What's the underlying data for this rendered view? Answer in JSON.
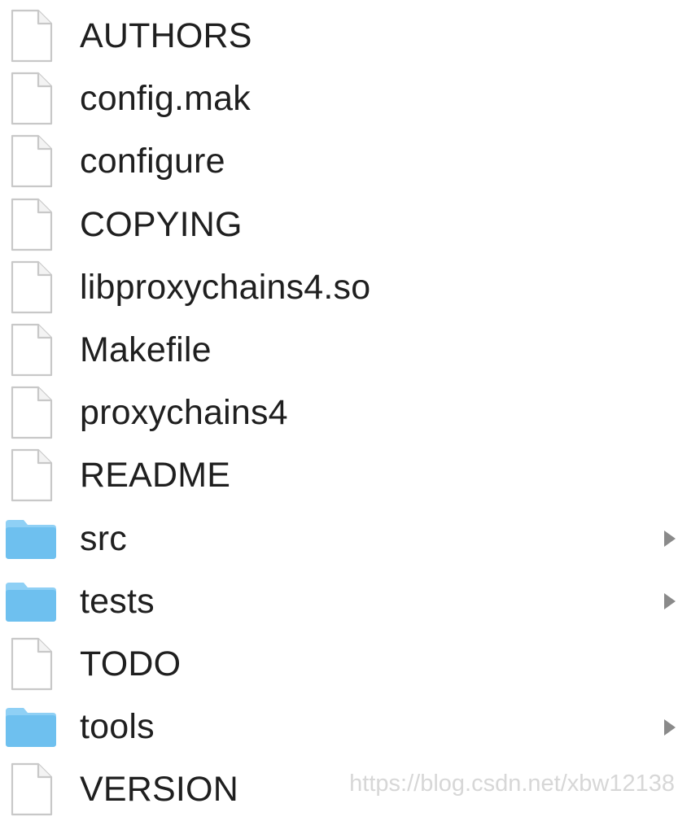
{
  "files": [
    {
      "name": "AUTHORS",
      "kind": "file",
      "icon": "document-icon"
    },
    {
      "name": "config.mak",
      "kind": "file",
      "icon": "document-icon"
    },
    {
      "name": "configure",
      "kind": "file",
      "icon": "document-icon"
    },
    {
      "name": "COPYING",
      "kind": "file",
      "icon": "document-icon"
    },
    {
      "name": "libproxychains4.so",
      "kind": "file",
      "icon": "document-icon"
    },
    {
      "name": "Makefile",
      "kind": "file",
      "icon": "document-icon"
    },
    {
      "name": "proxychains4",
      "kind": "file",
      "icon": "document-icon"
    },
    {
      "name": "README",
      "kind": "file",
      "icon": "document-icon"
    },
    {
      "name": "src",
      "kind": "folder",
      "icon": "folder-icon"
    },
    {
      "name": "tests",
      "kind": "folder",
      "icon": "folder-icon"
    },
    {
      "name": "TODO",
      "kind": "file",
      "icon": "document-icon"
    },
    {
      "name": "tools",
      "kind": "folder",
      "icon": "folder-icon"
    },
    {
      "name": "VERSION",
      "kind": "file",
      "icon": "document-icon"
    }
  ],
  "watermark": "https://blog.csdn.net/xbw12138",
  "colors": {
    "folder_fill": "#6ec0ef",
    "folder_tab": "#8fd0f5",
    "document_stroke": "#c8c8c8",
    "disclosure": "#8a8a8a",
    "text": "#1f1f1f"
  }
}
